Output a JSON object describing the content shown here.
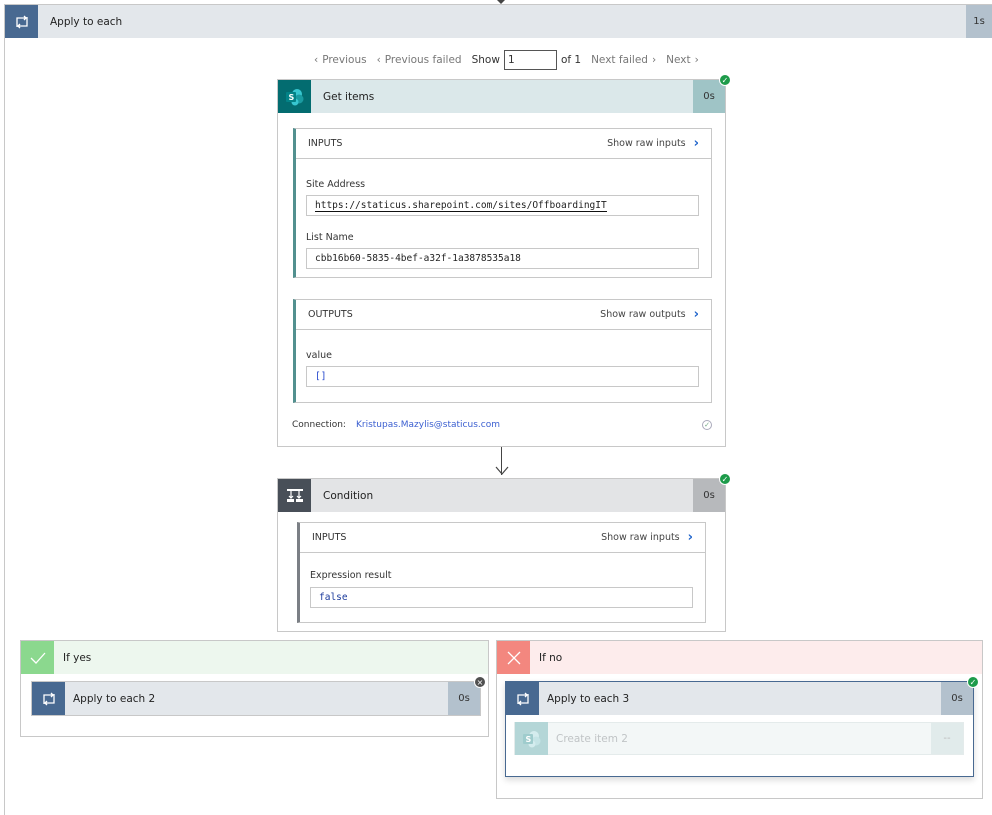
{
  "loop": {
    "title": "Apply to each",
    "duration": "1s"
  },
  "pager": {
    "previous": "Previous",
    "previous_failed": "Previous failed",
    "show": "Show",
    "current": "1",
    "of": "of 1",
    "next_failed": "Next failed",
    "next": "Next"
  },
  "get_items": {
    "title": "Get items",
    "duration": "0s",
    "inputs": {
      "label": "INPUTS",
      "raw_link": "Show raw inputs",
      "fields": [
        {
          "label": "Site Address",
          "value": "https://staticus.sharepoint.com/sites/OffboardingIT"
        },
        {
          "label": "List Name",
          "value": "cbb16b60-5835-4bef-a32f-1a3878535a18"
        }
      ]
    },
    "outputs": {
      "label": "OUTPUTS",
      "raw_link": "Show raw outputs",
      "fields": [
        {
          "label": "value",
          "value": "[]"
        }
      ]
    },
    "connection_label": "Connection:",
    "connection_value": "Kristupas.Mazylis@staticus.com"
  },
  "condition": {
    "title": "Condition",
    "duration": "0s",
    "inputs": {
      "label": "INPUTS",
      "raw_link": "Show raw inputs",
      "fields": [
        {
          "label": "Expression result",
          "value": "false"
        }
      ]
    }
  },
  "if_yes": {
    "title": "If yes",
    "child": {
      "title": "Apply to each 2",
      "duration": "0s"
    }
  },
  "if_no": {
    "title": "If no",
    "child": {
      "title": "Apply to each 3",
      "duration": "0s"
    },
    "inner": {
      "title": "Create item 2",
      "duration": "--"
    }
  },
  "colors": {
    "loop_icon_bg": "#486991",
    "sharepoint_bg": "#036c70",
    "condition_icon_bg": "#484f58",
    "success": "#1d9b4a",
    "yes_bg": "#edf7ee",
    "yes_icon": "#8bd88e",
    "no_bg": "#fdecec",
    "no_icon": "#f3877f",
    "link": "#2266cc"
  }
}
